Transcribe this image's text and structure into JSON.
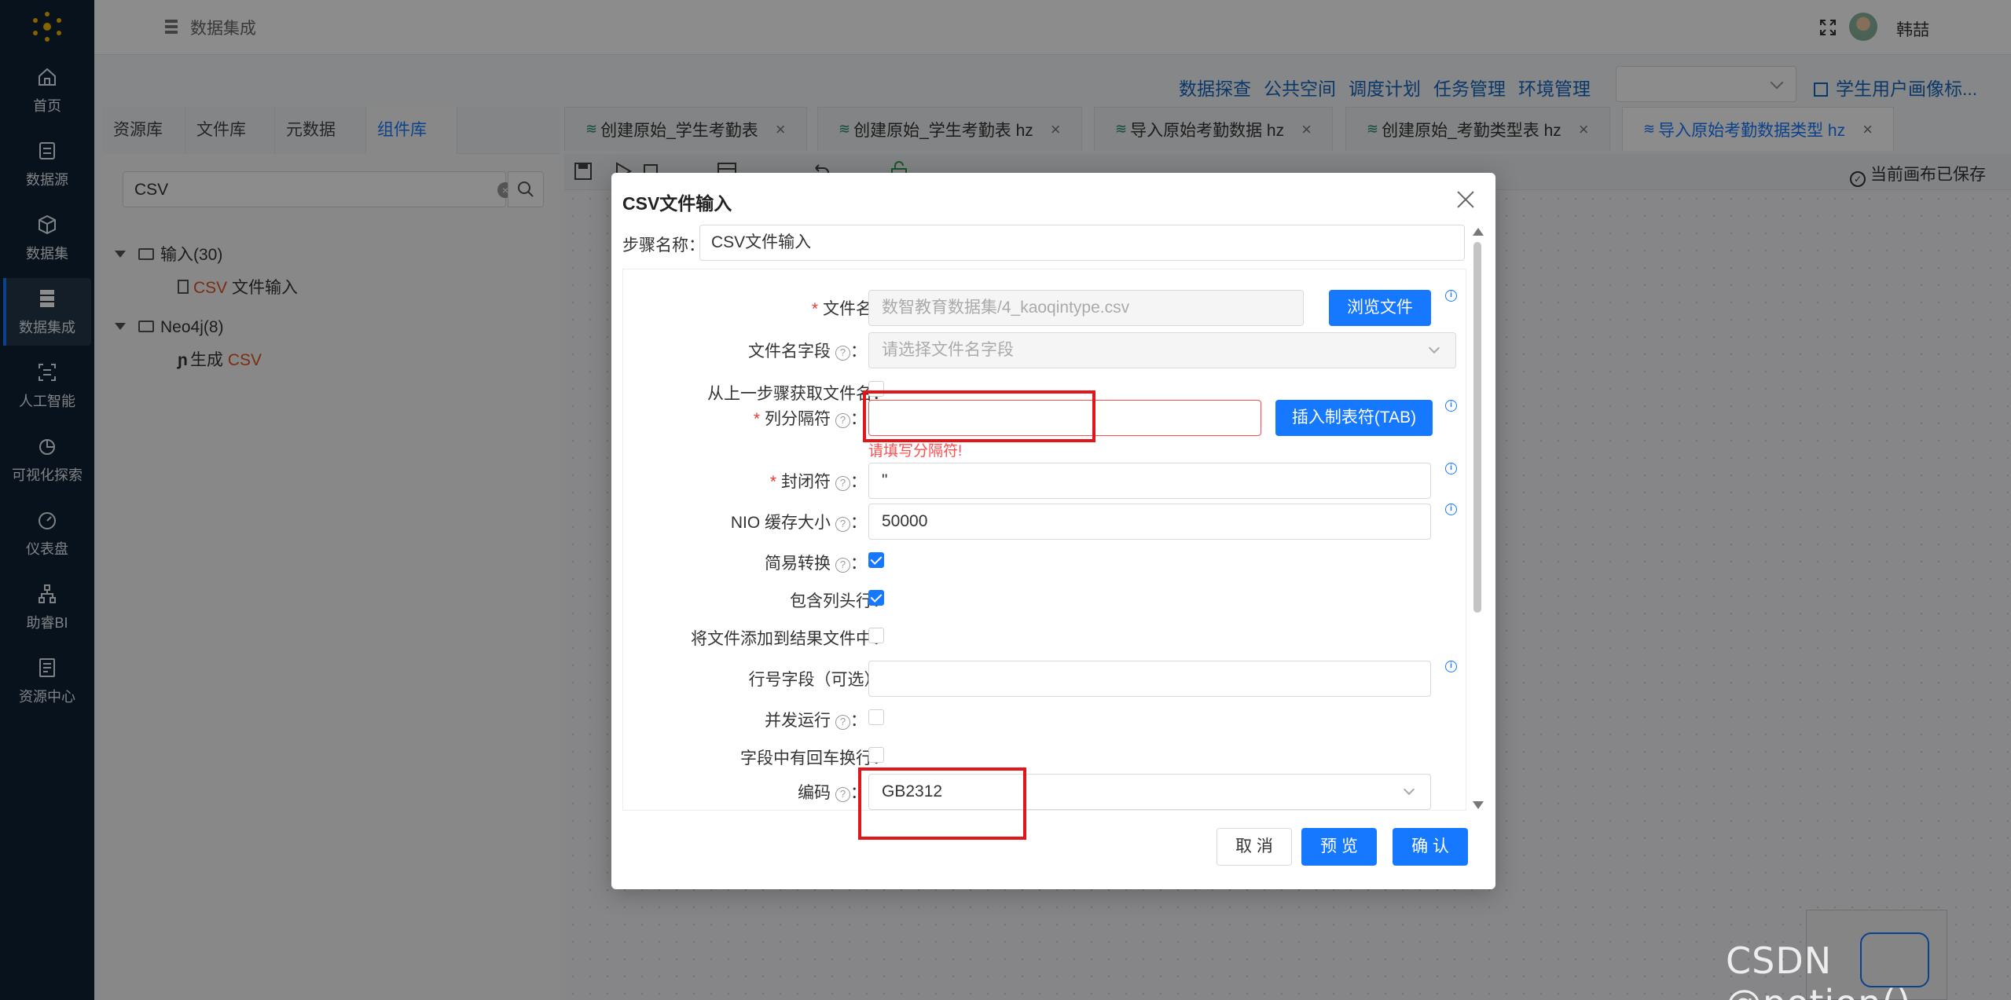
{
  "nav": {
    "items": [
      {
        "label": "首页",
        "icon": "home-icon"
      },
      {
        "label": "数据源",
        "icon": "database-icon"
      },
      {
        "label": "数据集",
        "icon": "cube-icon"
      },
      {
        "label": "数据集成",
        "icon": "server-icon"
      },
      {
        "label": "人工智能",
        "icon": "ai-icon"
      },
      {
        "label": "可视化探索",
        "icon": "pie-chart-icon"
      },
      {
        "label": "仪表盘",
        "icon": "gauge-icon"
      },
      {
        "label": "助睿BI",
        "icon": "org-chart-icon"
      },
      {
        "label": "资源中心",
        "icon": "resource-icon"
      }
    ],
    "active": "数据集成"
  },
  "header": {
    "title": "数据集成",
    "user": "韩喆"
  },
  "toplinks": [
    "数据探查",
    "公共空间",
    "调度计划",
    "任务管理",
    "环境管理"
  ],
  "project_link": "学生用户画像标...",
  "left_tabs": [
    "资源库",
    "文件库",
    "元数据",
    "组件库"
  ],
  "left_active_tab": "组件库",
  "search": {
    "value": "CSV"
  },
  "tree": {
    "group1": {
      "label": "输入(30)",
      "child_hl": "CSV",
      "child_rest": " 文件输入"
    },
    "group2": {
      "label": "Neo4j(8)",
      "child_pre": "生成 ",
      "child_hl": "CSV"
    }
  },
  "editor_tabs": [
    {
      "label": "创建原始_学生考勤表"
    },
    {
      "label": "创建原始_学生考勤表 hz"
    },
    {
      "label": "导入原始考勤数据 hz"
    },
    {
      "label": "创建原始_考勤类型表 hz"
    },
    {
      "label": "导入原始考勤数据类型 hz"
    }
  ],
  "canvas_status": "当前画布已保存",
  "dialog": {
    "title": "CSV文件输入",
    "step_label": "步骤名称",
    "step_value": "CSV文件输入",
    "filename_label": "文件名",
    "filename_value": "数智教育数据集/4_kaoqintype.csv",
    "browse_btn": "浏览文件",
    "filename_field_label": "文件名字段",
    "filename_field_placeholder": "请选择文件名字段",
    "from_prev_label": "从上一步骤获取文件名",
    "separator_label": "列分隔符",
    "separator_value": "",
    "insert_tab_btn": "插入制表符(TAB)",
    "separator_error": "请填写分隔符!",
    "enclosure_label": "封闭符",
    "enclosure_value": "\"",
    "nio_label": "NIO 缓存大小",
    "nio_value": "50000",
    "lazy_label": "简易转换",
    "header_label": "包含列头行",
    "add_result_label": "将文件添加到结果文件中",
    "rownum_label": "行号字段（可选）",
    "rownum_value": "",
    "parallel_label": "并发运行",
    "newline_label": "字段中有回车换行",
    "encoding_label": "编码",
    "encoding_value": "GB2312",
    "cancel_btn": "取 消",
    "preview_btn": "预 览",
    "confirm_btn": "确 认",
    "checks": {
      "from_prev": false,
      "lazy": true,
      "header": true,
      "add_result": false,
      "parallel": false,
      "newline": false
    }
  },
  "watermark": "CSDN @potion()"
}
